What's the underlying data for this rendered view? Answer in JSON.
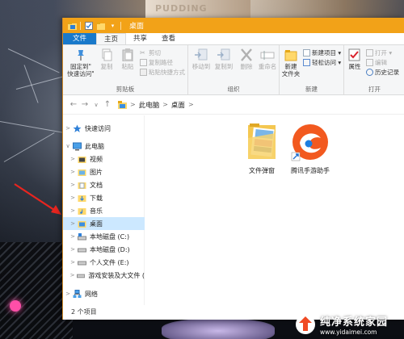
{
  "window": {
    "title": "桌面",
    "accent_color": "#f2a218",
    "file_tab_color": "#1979ca"
  },
  "ribbon_tabs": [
    "文件",
    "主页",
    "共享",
    "查看"
  ],
  "ribbon": {
    "clipboard": {
      "pin_label_1": "固定到\"",
      "pin_label_2": "快速访问\"",
      "copy_label": "复制",
      "paste_label": "粘贴",
      "cut_label": "剪切",
      "copy_path_label": "复制路径",
      "paste_shortcut_label": "粘贴快捷方式",
      "group_label": "剪贴板"
    },
    "organize": {
      "move_to_label": "移动到",
      "copy_to_label": "复制到",
      "delete_label": "删除",
      "rename_label": "重命名",
      "group_label": "组织"
    },
    "new": {
      "new_folder_label_1": "新建",
      "new_folder_label_2": "文件夹",
      "new_item_label": "新建项目 ▾",
      "easy_access_label": "轻松访问 ▾",
      "group_label": "新建"
    },
    "open": {
      "properties_label": "属性",
      "open_label": "打开 ▾",
      "edit_label": "编辑",
      "history_label": "历史记录",
      "group_label": "打开"
    }
  },
  "address": {
    "back_icon": "←",
    "forward_icon": "→",
    "dropdown_icon": "∨",
    "up_icon": "↑",
    "crumbs": [
      "此电脑",
      "桌面"
    ],
    "separator": ">"
  },
  "nav": {
    "items": [
      {
        "label": "快速访问",
        "icon": "star-icon"
      },
      {
        "label": "此电脑",
        "icon": "computer-icon"
      },
      {
        "label": "视频",
        "icon": "video-folder-icon"
      },
      {
        "label": "图片",
        "icon": "pictures-folder-icon"
      },
      {
        "label": "文档",
        "icon": "documents-folder-icon"
      },
      {
        "label": "下载",
        "icon": "downloads-folder-icon"
      },
      {
        "label": "音乐",
        "icon": "music-folder-icon"
      },
      {
        "label": "桌面",
        "icon": "desktop-folder-icon"
      },
      {
        "label": "本地磁盘 (C:)",
        "icon": "system-drive-icon"
      },
      {
        "label": "本地磁盘 (D:)",
        "icon": "drive-icon"
      },
      {
        "label": "个人文件 (E:)",
        "icon": "drive-icon"
      },
      {
        "label": "游戏安装及大文件 (",
        "icon": "drive-icon"
      },
      {
        "label": "网络",
        "icon": "network-icon"
      }
    ],
    "selected": "桌面"
  },
  "files": [
    {
      "name": "文件弹窗",
      "icon": "folder-icon"
    },
    {
      "name": "腾讯手游助手",
      "icon": "app-shortcut-icon"
    }
  ],
  "status": {
    "count_text": "2 个项目"
  },
  "watermark": {
    "main": "纯净系统家园",
    "sub": "www.yidaimei.com"
  },
  "wallpaper": {
    "top_text": "PUDDING"
  }
}
